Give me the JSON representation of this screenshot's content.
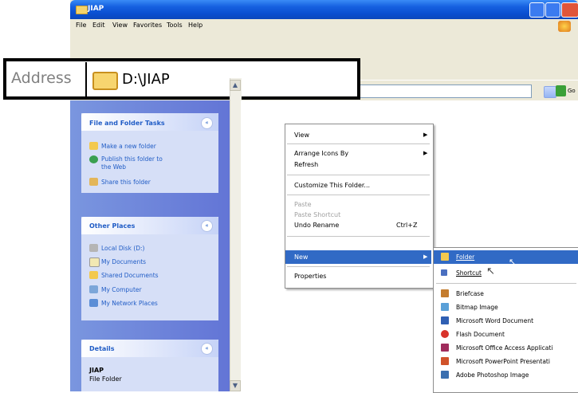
{
  "window": {
    "title": "JIAP"
  },
  "menubar": [
    "File",
    "Edit",
    "View",
    "Favorites",
    "Tools",
    "Help"
  ],
  "address": {
    "label": "Address",
    "path": "D:\\JIAP",
    "go_label": "Go"
  },
  "panels": {
    "file_folder_tasks": {
      "title": "File and Folder Tasks",
      "items": [
        "Make a new folder",
        "Publish this folder to",
        "the Web",
        "Share this folder"
      ]
    },
    "other_places": {
      "title": "Other Places",
      "items": [
        "Local Disk (D:)",
        "My Documents",
        "Shared Documents",
        "My Computer",
        "My Network Places"
      ]
    },
    "details": {
      "title": "Details",
      "name": "JIAP",
      "type": "File Folder"
    }
  },
  "context_menu": {
    "view": "View",
    "arrange": "Arrange Icons By",
    "refresh": "Refresh",
    "customize": "Customize This Folder...",
    "paste": "Paste",
    "paste_shortcut": "Paste Shortcut",
    "undo": "Undo Rename",
    "undo_shortcut": "Ctrl+Z",
    "new": "New",
    "properties": "Properties"
  },
  "new_submenu": {
    "folder": "Folder",
    "shortcut": "Shortcut",
    "items": [
      "Briefcase",
      "Bitmap Image",
      "Microsoft Word Document",
      "Flash Document",
      "Microsoft Office Access Applicati",
      "Microsoft PowerPoint Presentati",
      "Adobe Photoshop Image"
    ]
  },
  "colors": {
    "highlight": "#316ac5",
    "titlebar": "#0a4fd1",
    "panel_title": "#215dc6"
  }
}
